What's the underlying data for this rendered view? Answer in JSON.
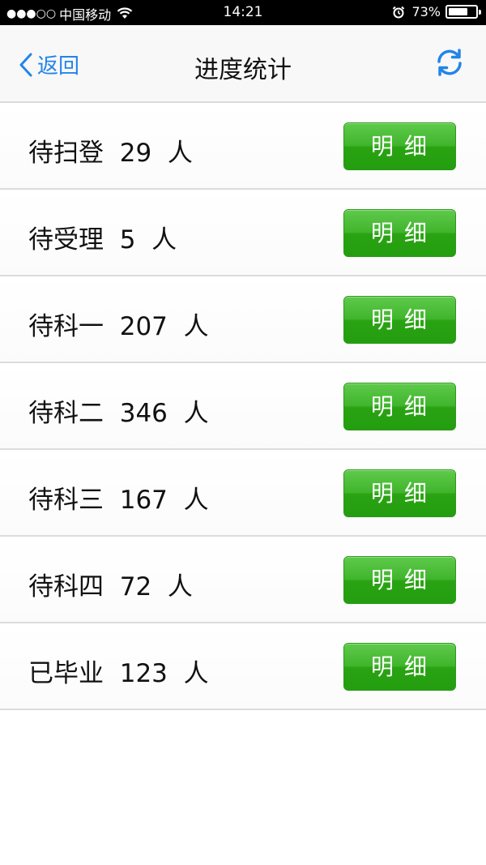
{
  "status_bar": {
    "signal": "●●●○○",
    "carrier": "中国移动",
    "time": "14:21",
    "battery_percent": "73%",
    "battery_level": 0.73
  },
  "nav": {
    "back_label": "返回",
    "title": "进度统计",
    "refresh_icon": "refresh-icon"
  },
  "colors": {
    "accent": "#2384e8",
    "button_green": "#2aa312"
  },
  "rows": [
    {
      "label": "待扫登",
      "count": "29",
      "unit": "人",
      "button": "明  细"
    },
    {
      "label": "待受理",
      "count": "5",
      "unit": "人",
      "button": "明  细"
    },
    {
      "label": "待科一",
      "count": "207",
      "unit": "人",
      "button": "明  细"
    },
    {
      "label": "待科二",
      "count": "346",
      "unit": "人",
      "button": "明  细"
    },
    {
      "label": "待科三",
      "count": "167",
      "unit": "人",
      "button": "明  细"
    },
    {
      "label": "待科四",
      "count": "72",
      "unit": "人",
      "button": "明  细"
    },
    {
      "label": "已毕业",
      "count": "123",
      "unit": "人",
      "button": "明  细"
    }
  ]
}
